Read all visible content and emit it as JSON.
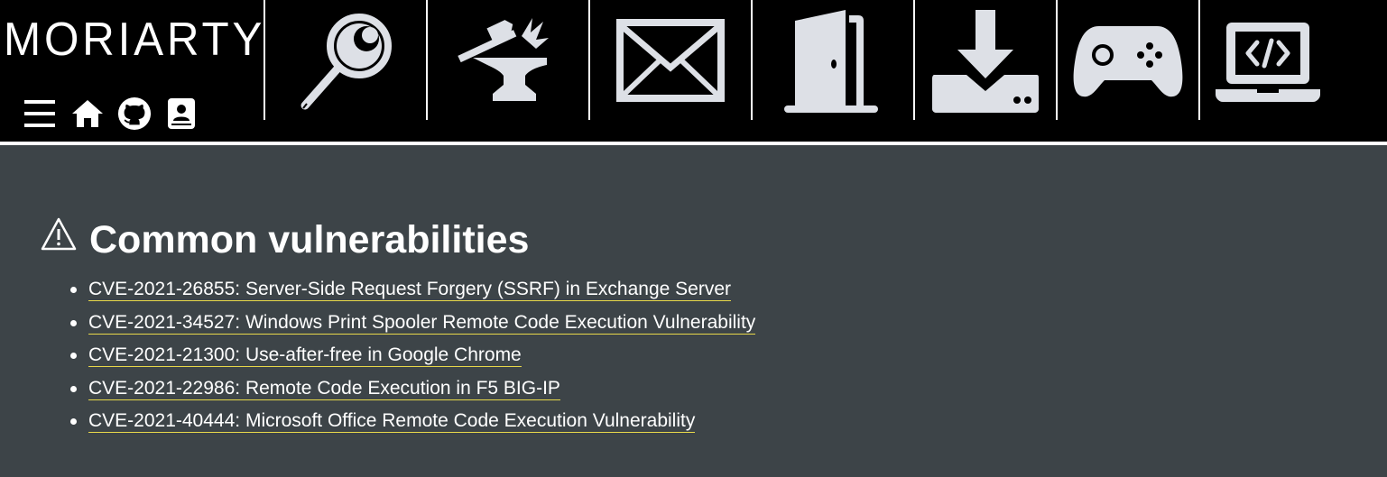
{
  "brand": {
    "logo_text": "MORIARTY"
  },
  "mini_nav": [
    {
      "icon": "menu-icon",
      "label": "Menu"
    },
    {
      "icon": "home-icon",
      "label": "Home"
    },
    {
      "icon": "github-icon",
      "label": "GitHub"
    },
    {
      "icon": "contact-book-icon",
      "label": "Contact"
    }
  ],
  "nav_icons": [
    {
      "icon": "magnifying-glass-icon"
    },
    {
      "icon": "anvil-hammer-icon"
    },
    {
      "icon": "envelope-icon"
    },
    {
      "icon": "door-icon"
    },
    {
      "icon": "download-icon"
    },
    {
      "icon": "gamepad-icon"
    },
    {
      "icon": "laptop-code-icon"
    }
  ],
  "colors": {
    "background": "#3d4448",
    "header": "#000000",
    "icon": "#dde0e6",
    "link_underline": "#e8d84a",
    "text": "#ffffff"
  },
  "section": {
    "title": "Common vulnerabilities",
    "items": [
      "CVE-2021-26855: Server-Side Request Forgery (SSRF) in Exchange Server",
      "CVE-2021-34527: Windows Print Spooler Remote Code Execution Vulnerability",
      "CVE-2021-21300: Use-after-free in Google Chrome",
      "CVE-2021-22986: Remote Code Execution in F5 BIG-IP",
      "CVE-2021-40444: Microsoft Office Remote Code Execution Vulnerability"
    ]
  }
}
